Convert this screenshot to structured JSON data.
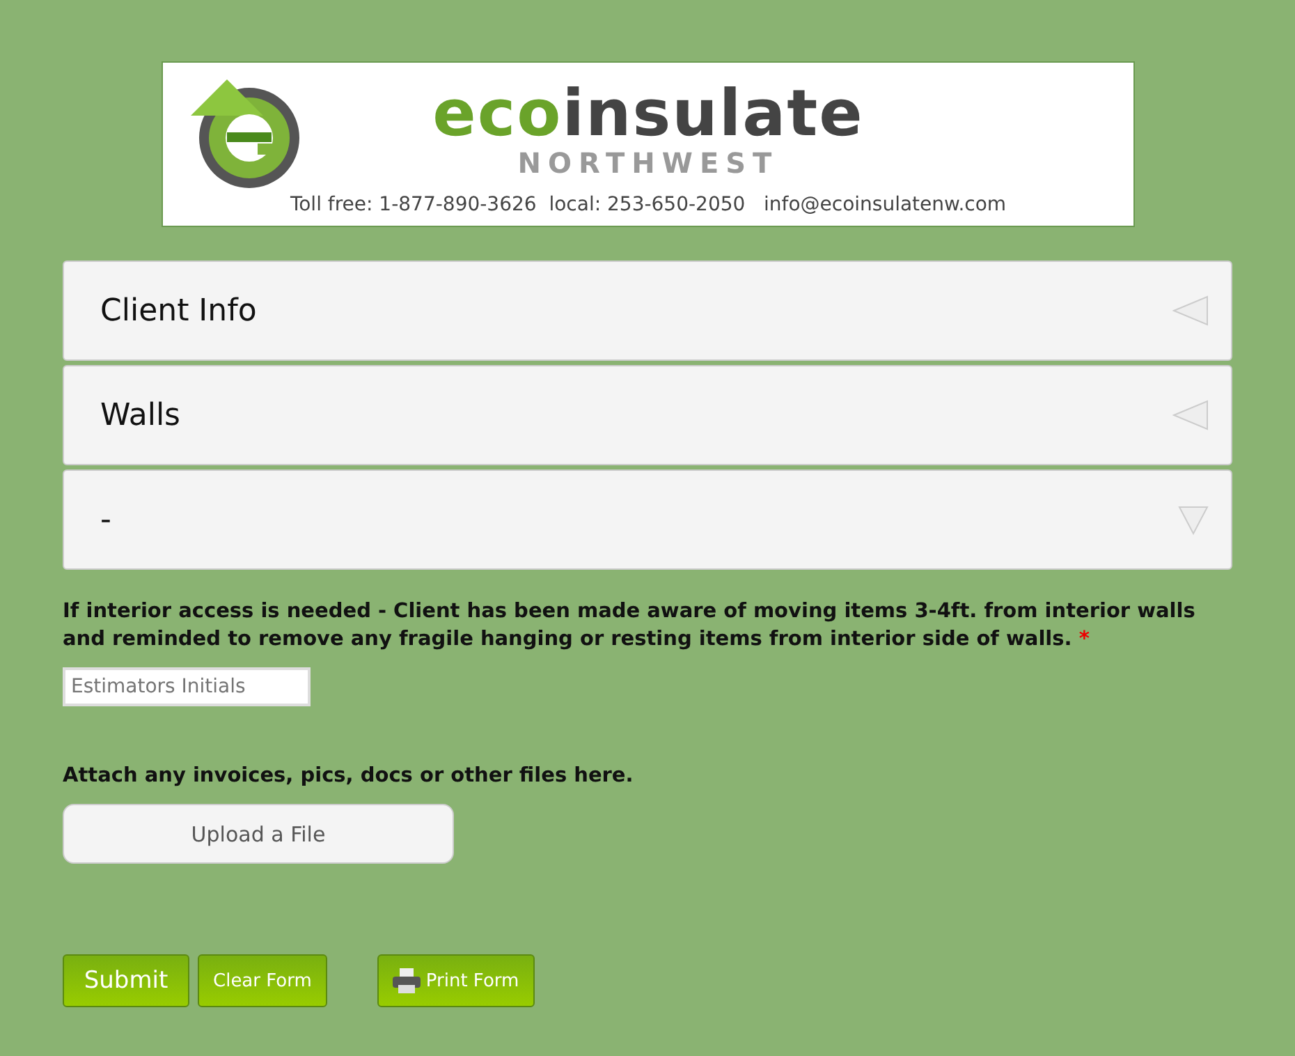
{
  "header": {
    "brand_prefix": "eco",
    "brand_rest": "insulate",
    "region": "NORTHWEST",
    "contact": "Toll free: 1-877-890-3626  local: 253-650-2050   info@ecoinsulatenw.com"
  },
  "sections": [
    {
      "title": "Client Info",
      "expanded": false
    },
    {
      "title": "Walls",
      "expanded": false
    },
    {
      "title": "-",
      "expanded": true
    }
  ],
  "question": {
    "label": "If interior access is needed - Client has been made aware of moving items 3-4ft. from interior walls and reminded to remove any fragile hanging or resting items from interior side of walls.",
    "required_mark": "*",
    "placeholder": "Estimators Initials"
  },
  "attach": {
    "label": "Attach any invoices, pics, docs or other files here.",
    "button": "Upload a File"
  },
  "buttons": [
    {
      "label": "Submit",
      "kind": "submit"
    },
    {
      "label": "Clear Form",
      "kind": "clear"
    },
    {
      "label": "Print Form",
      "kind": "print"
    }
  ]
}
